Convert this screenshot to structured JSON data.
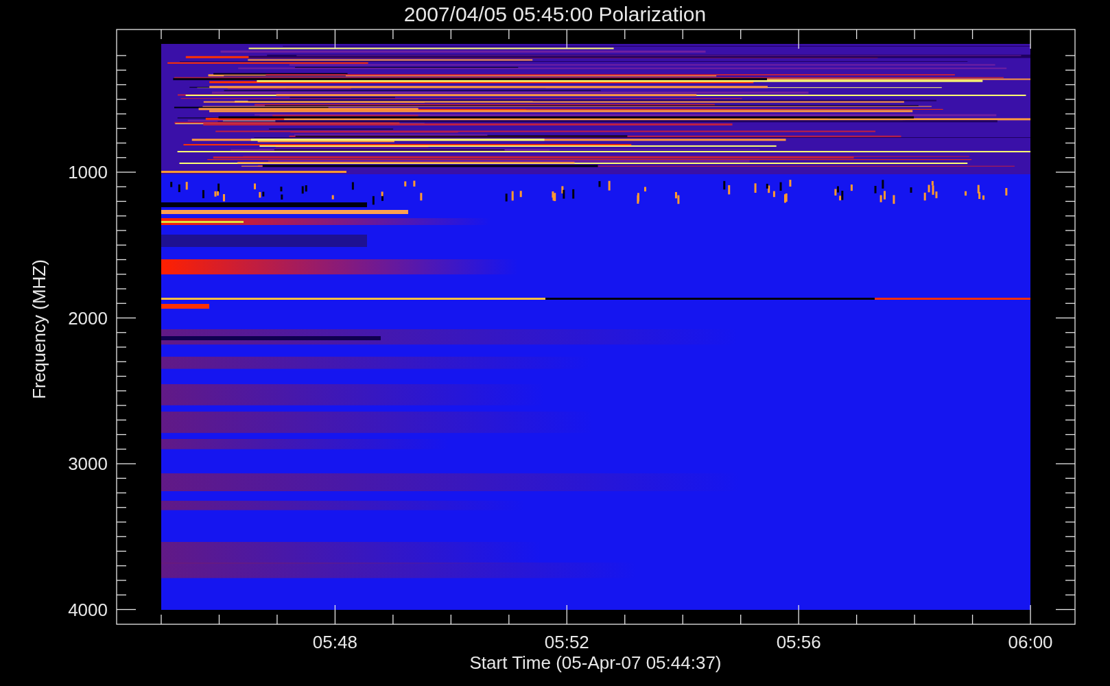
{
  "title": "2007/04/05 05:45:00 Polarization",
  "y_axis": {
    "label": "Frequency (MHZ)",
    "ticks": [
      "1000",
      "2000",
      "3000",
      "4000"
    ]
  },
  "x_axis": {
    "label": "Start Time (05-Apr-07 05:44:37)",
    "ticks": [
      "05:48",
      "05:52",
      "05:56",
      "06:00"
    ]
  }
}
